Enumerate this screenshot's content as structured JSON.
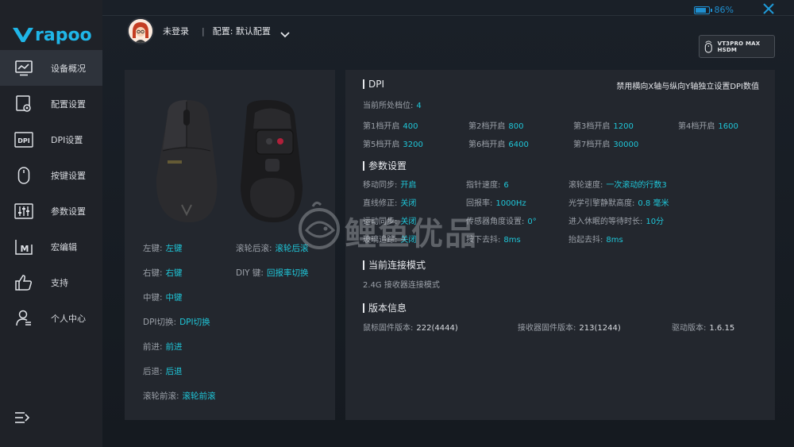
{
  "app": {
    "logo_text": "rapoo",
    "battery_percent": "86%",
    "battery_level": 0.86,
    "accent": "#1fc6d8",
    "brand_blue": "#1fb6e8"
  },
  "sidebar": {
    "items": [
      {
        "label": "设备概况",
        "icon": "monitor-chart-icon",
        "active": true
      },
      {
        "label": "配置设置",
        "icon": "settings-page-icon",
        "active": false
      },
      {
        "label": "DPI设置",
        "icon": "dpi-icon",
        "active": false
      },
      {
        "label": "按键设置",
        "icon": "mouse-icon",
        "active": false
      },
      {
        "label": "参数设置",
        "icon": "sliders-icon",
        "active": false
      },
      {
        "label": "宏编辑",
        "icon": "macro-icon",
        "active": false
      },
      {
        "label": "支持",
        "icon": "thumbs-up-icon",
        "active": false
      },
      {
        "label": "个人中心",
        "icon": "user-icon",
        "active": false
      }
    ]
  },
  "header": {
    "user_name": "未登录",
    "separator": "|",
    "config_label": "配置: 默认配置",
    "device_name": "VT3PRO MAX HSDM"
  },
  "keys": {
    "left_label": "左键:",
    "left_value": "左键",
    "wheel_back_label": "滚轮后滚:",
    "wheel_back_value": "滚轮后滚",
    "right_label": "右键:",
    "right_value": "右键",
    "diy_label": "DIY 键:",
    "diy_value": "回报率切换",
    "middle_label": "中键:",
    "middle_value": "中键",
    "dpi_label": "DPI切换:",
    "dpi_value": "DPI切换",
    "forward_label": "前进:",
    "forward_value": "前进",
    "back_label": "后退:",
    "back_value": "后退",
    "wheel_fwd_label": "滚轮前滚:",
    "wheel_fwd_value": "滚轮前滚"
  },
  "dpi": {
    "title": "DPI",
    "note": "禁用横向X轴与纵向Y轴独立设置DPI数值",
    "current_label": "当前所处档位:",
    "current_value": "4",
    "levels": [
      {
        "label": "第1档开启",
        "value": "400"
      },
      {
        "label": "第2档开启",
        "value": "800"
      },
      {
        "label": "第3档开启",
        "value": "1200"
      },
      {
        "label": "第4档开启",
        "value": "1600"
      },
      {
        "label": "第5档开启",
        "value": "3200"
      },
      {
        "label": "第6档开启",
        "value": "6400"
      },
      {
        "label": "第7档开启",
        "value": "30000"
      }
    ]
  },
  "params": {
    "title": "参数设置",
    "move_sync_label": "移动同步:",
    "move_sync_value": "开启",
    "pointer_speed_label": "指针速度:",
    "pointer_speed_value": "6",
    "scroll_speed_label": "滚轮速度:",
    "scroll_speed_value": "一次滚动的行数3",
    "straight_label": "直线修正:",
    "straight_value": "关闭",
    "report_rate_label": "回报率:",
    "report_rate_value": "1000Hz",
    "lod_label": "光学引擎静默高度:",
    "lod_value": "0.8 毫米",
    "motion_sync_label": "运动同步:",
    "motion_sync_value": "关闭",
    "angle_label": "传感器角度设置:",
    "angle_value": "0°",
    "sleep_label": "进入休眠的等待时长:",
    "sleep_value": "10分",
    "glass_label": "玻璃追踪:",
    "glass_value": "关闭",
    "press_debounce_label": "按下去抖:",
    "press_debounce_value": "8ms",
    "release_debounce_label": "抬起去抖:",
    "release_debounce_value": "8ms"
  },
  "connection": {
    "title": "当前连接模式",
    "mode": "2.4G 接收器连接模式"
  },
  "version": {
    "title": "版本信息",
    "mouse_fw_label": "鼠标固件版本:",
    "mouse_fw_value": "222(4444)",
    "receiver_fw_label": "接收器固件版本:",
    "receiver_fw_value": "213(1244)",
    "driver_label": "驱动版本:",
    "driver_value": "1.6.15"
  },
  "watermark": "鲤鱼优品"
}
